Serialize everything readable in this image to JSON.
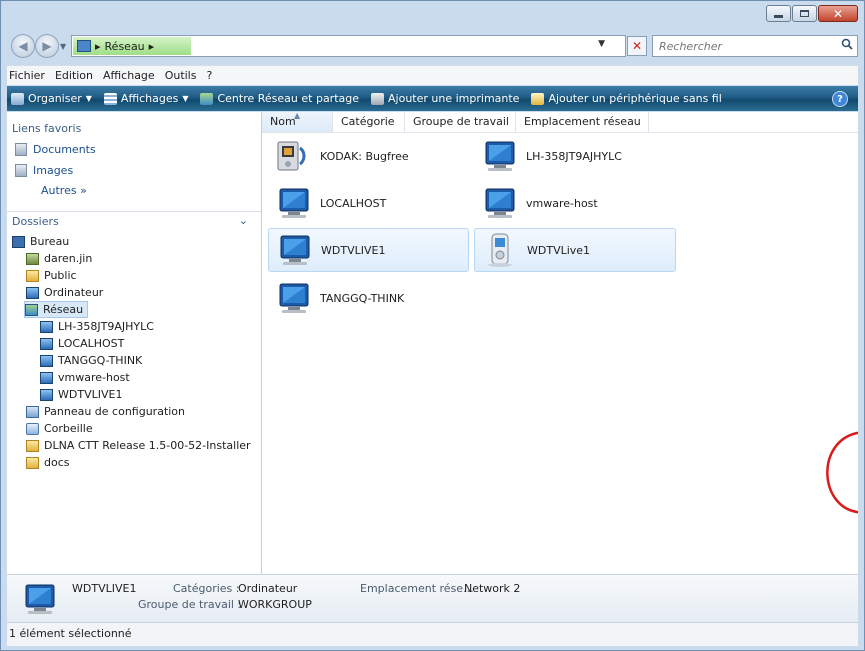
{
  "address": {
    "crumb": "Réseau",
    "crumb_arrow": "▸"
  },
  "search": {
    "placeholder": "Rechercher"
  },
  "menubar": {
    "items": [
      "Fichier",
      "Edition",
      "Affichage",
      "Outils",
      "?"
    ]
  },
  "commandbar": {
    "items": [
      {
        "label": "Organiser",
        "has_dropdown": true
      },
      {
        "label": "Affichages",
        "has_dropdown": true
      },
      {
        "label": "Centre Réseau et partage",
        "has_dropdown": false
      },
      {
        "label": "Ajouter une imprimante",
        "has_dropdown": false
      },
      {
        "label": "Ajouter un périphérique sans fil",
        "has_dropdown": false
      }
    ]
  },
  "favorites": {
    "heading": "Liens favoris",
    "links": [
      "Documents",
      "Images"
    ],
    "more": "Autres",
    "more_arrow": "»"
  },
  "folders": {
    "heading": "Dossiers",
    "tree": [
      {
        "label": "Bureau",
        "level": 0,
        "icon": "desktop-icon"
      },
      {
        "label": "daren.jin",
        "level": 1,
        "icon": "user-folder-icon"
      },
      {
        "label": "Public",
        "level": 1,
        "icon": "folder-icon"
      },
      {
        "label": "Ordinateur",
        "level": 1,
        "icon": "computer-icon"
      },
      {
        "label": "Réseau",
        "level": 1,
        "icon": "network-icon",
        "selected": true
      },
      {
        "label": "LH-358JT9AJHYLC",
        "level": 2,
        "icon": "computer-icon"
      },
      {
        "label": "LOCALHOST",
        "level": 2,
        "icon": "computer-icon"
      },
      {
        "label": "TANGGQ-THINK",
        "level": 2,
        "icon": "computer-icon"
      },
      {
        "label": "vmware-host",
        "level": 2,
        "icon": "computer-icon"
      },
      {
        "label": "WDTVLIVE1",
        "level": 2,
        "icon": "computer-icon"
      },
      {
        "label": "Panneau de configuration",
        "level": 1,
        "icon": "control-panel-icon"
      },
      {
        "label": "Corbeille",
        "level": 1,
        "icon": "recycle-bin-icon"
      },
      {
        "label": "DLNA CTT Release 1.5-00-52-Installer",
        "level": 1,
        "icon": "folder-icon"
      },
      {
        "label": "docs",
        "level": 1,
        "icon": "folder-icon"
      }
    ]
  },
  "columns": [
    "Nom",
    "Catégorie",
    "Groupe de travail",
    "Emplacement réseau"
  ],
  "items": [
    {
      "label": "KODAK: Bugfree",
      "icon": "media-device-icon"
    },
    {
      "label": "LH-358JT9AJHYLC",
      "icon": "computer-icon"
    },
    {
      "label": "LOCALHOST",
      "icon": "computer-icon"
    },
    {
      "label": "vmware-host",
      "icon": "computer-icon"
    },
    {
      "label": "WDTVLIVE1",
      "icon": "computer-icon",
      "selected": true
    },
    {
      "label": "WDTVLive1",
      "icon": "media-player-icon",
      "hovered": true
    },
    {
      "label": "TANGGQ-THINK",
      "icon": "computer-icon"
    }
  ],
  "details": {
    "name": "WDTVLIVE1",
    "category_label": "Catégories :",
    "category_value": "Ordinateur",
    "workgroup_label": "Groupe de travail :",
    "workgroup_value": "WORKGROUP",
    "location_label": "Emplacement rése...",
    "location_value": "Network 2"
  },
  "status": {
    "text": "1 élément sélectionné"
  },
  "colors": {
    "annotation": "#d81b1b",
    "selection": "#d9e8f7",
    "command_bar": "#1f5c84"
  }
}
